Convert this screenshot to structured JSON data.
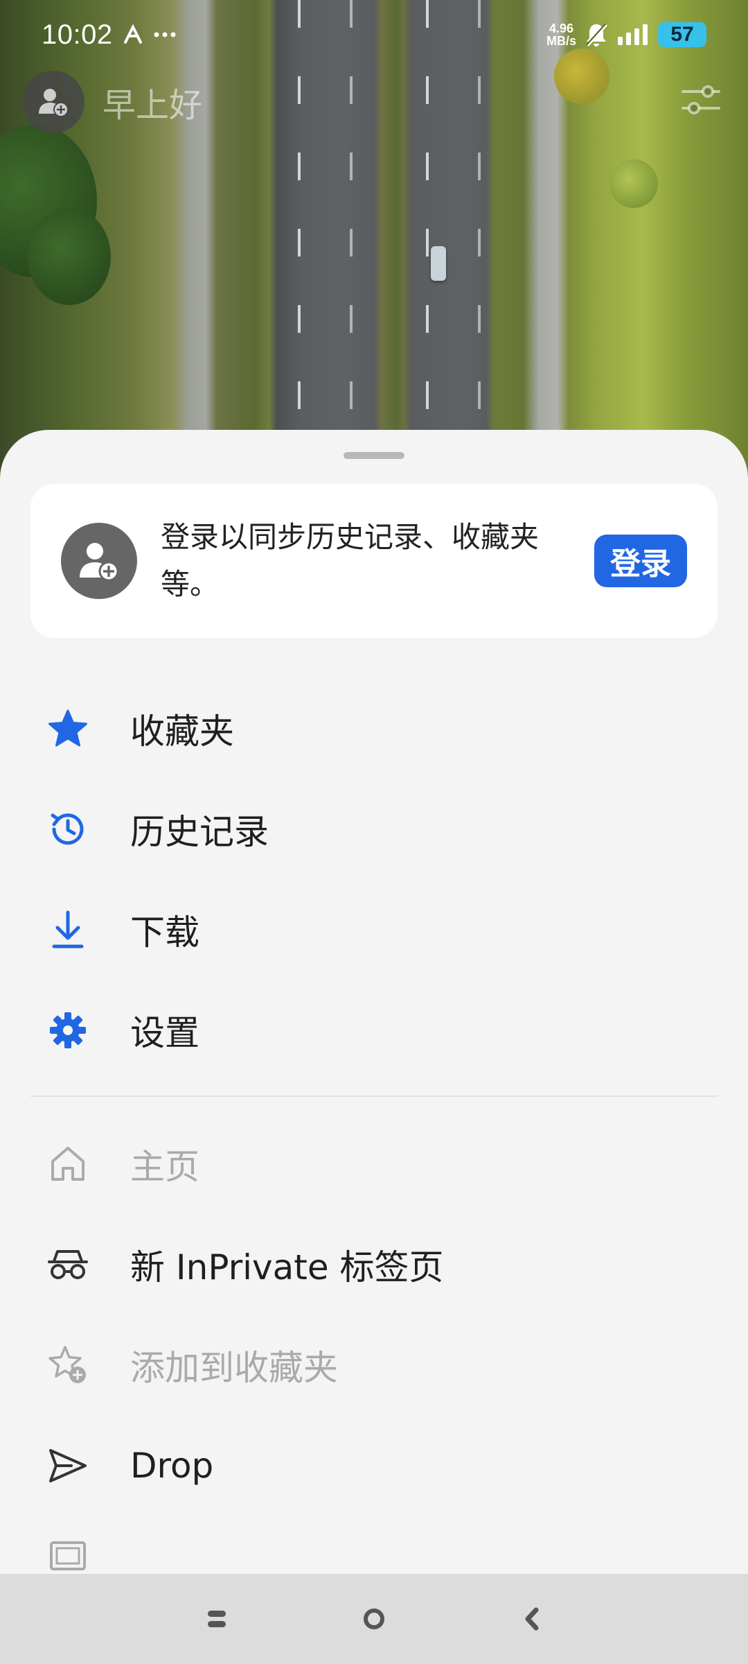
{
  "status_bar": {
    "time": "10:02",
    "net_speed_value": "4.96",
    "net_speed_unit": "MB/s",
    "battery": "57",
    "icons": [
      "a-icon",
      "more-dots-icon",
      "mute-bell-icon",
      "signal-icon",
      "battery-icon"
    ]
  },
  "header": {
    "greeting": "早上好",
    "avatar_icon": "add-user-icon",
    "filter_icon": "sliders-icon"
  },
  "signin": {
    "message": "登录以同步历史记录、收藏夹等。",
    "button_label": "登录"
  },
  "colors": {
    "accent": "#2167e3",
    "icon_blue": "#2167e3",
    "disabled": "#aaaaaa",
    "sheet_bg": "#f4f4f4"
  },
  "menu": {
    "primary": [
      {
        "label": "收藏夹",
        "icon": "star-icon"
      },
      {
        "label": "历史记录",
        "icon": "history-icon"
      },
      {
        "label": "下载",
        "icon": "download-icon"
      },
      {
        "label": "设置",
        "icon": "gear-icon"
      }
    ],
    "secondary": [
      {
        "label": "主页",
        "icon": "home-icon",
        "enabled": false
      },
      {
        "label": "新 InPrivate 标签页",
        "icon": "inprivate-icon",
        "enabled": true
      },
      {
        "label": "添加到收藏夹",
        "icon": "add-favorite-icon",
        "enabled": false
      },
      {
        "label": "Drop",
        "icon": "send-icon",
        "enabled": true
      }
    ]
  },
  "nav_bar": {
    "buttons": [
      "recents-button",
      "home-button",
      "back-button"
    ]
  }
}
